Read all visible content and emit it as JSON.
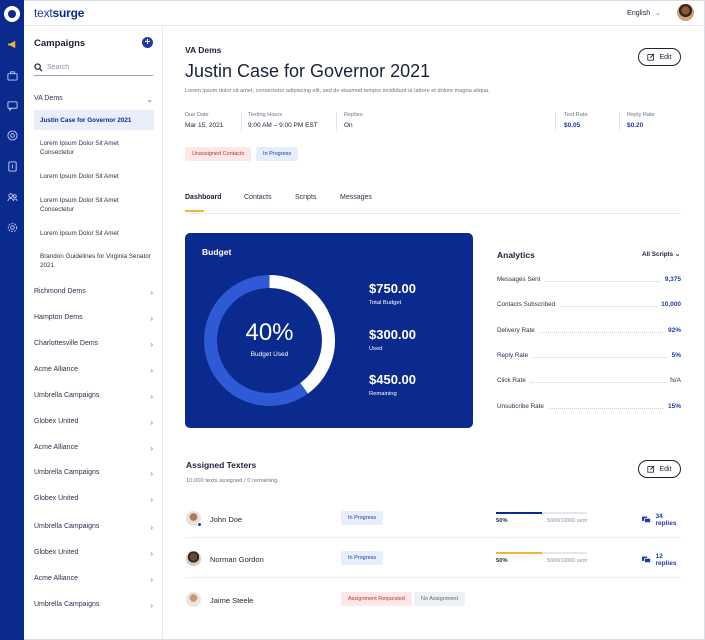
{
  "brand": {
    "name_light": "text",
    "name_bold": "surge"
  },
  "topbar": {
    "language": "English"
  },
  "sidebar": {
    "title": "Campaigns",
    "add_label": "+",
    "search_placeholder": "Search",
    "groups": [
      {
        "label": "VA Dems",
        "expanded": true
      },
      {
        "label": "Richmond Dems"
      },
      {
        "label": "Hampton Dems"
      },
      {
        "label": "Charlottesville Dems"
      },
      {
        "label": "Acme Alliance"
      },
      {
        "label": "Umbrella Campaigns"
      },
      {
        "label": "Globex United"
      },
      {
        "label": "Acme Alliance"
      },
      {
        "label": "Umbrella Campaigns"
      },
      {
        "label": "Globex United"
      },
      {
        "label": "Umbrella Campaigns"
      },
      {
        "label": "Globex United"
      },
      {
        "label": "Acme Alliance"
      },
      {
        "label": "Umbrella Campaigns"
      }
    ],
    "sub_items": [
      {
        "label": "Justin Case for Governor 2021",
        "active": true
      },
      {
        "label": "Lorem Ipsum Dolor Sit Amet Consectetur"
      },
      {
        "label": "Lorem Ipsum Dolor Sit Amet"
      },
      {
        "label": "Lorem Ipsum Dolor Sit Amet Consectetur"
      },
      {
        "label": "Lorem Ipsum Dolor Sit Amet"
      },
      {
        "label": "Brandon Guidelines for Virginia Senator 2021"
      }
    ]
  },
  "campaign": {
    "org": "VA Dems",
    "title": "Justin Case for Governor 2021",
    "description": "Lorem ipsum dolor sit amet, consectetur adipiscing elit, sed do eiusmod tempor incididunt ut labore et dolore magna aliqua.",
    "edit_label": "Edit",
    "meta": {
      "due_date_label": "Due Date",
      "due_date": "Mar 15, 2021",
      "hours_label": "Texting Hours",
      "hours": "9:00 AM – 9:00 PM EST",
      "replies_label": "Replies",
      "replies": "On",
      "text_rate_label": "Text Rate",
      "text_rate": "$0.05",
      "reply_rate_label": "Reply Rate",
      "reply_rate": "$0.20"
    },
    "badges": [
      "Unassigned Contacts",
      "In Progress"
    ]
  },
  "tabs": [
    "Dashboard",
    "Contacts",
    "Scripts",
    "Messages"
  ],
  "budget": {
    "title": "Budget",
    "used_fraction": 0.4,
    "percent_label": "40%",
    "percent_caption": "Budget Used",
    "total": "$750.00",
    "total_label": "Total Budget",
    "used": "$300.00",
    "used_label": "Used",
    "remaining": "$450.00",
    "remaining_label": "Remaining"
  },
  "analytics": {
    "title": "Analytics",
    "filter": "All Scripts",
    "rows": [
      {
        "label": "Messages Sent",
        "value": "9,375"
      },
      {
        "label": "Contacts Subscribed",
        "value": "10,000"
      },
      {
        "label": "Delivery Rate",
        "value": "92%"
      },
      {
        "label": "Reply Rate",
        "value": "5%"
      },
      {
        "label": "Click Rate",
        "value": "N/A"
      },
      {
        "label": "Unsubcribe Rate",
        "value": "15%"
      }
    ]
  },
  "texters": {
    "title": "Assigned Texters",
    "subtitle": "10,000 texts assigned / 0 remaining",
    "edit_label": "Edit",
    "rows": [
      {
        "name": "John Doe",
        "status": "In Progress",
        "progress": 0.5,
        "progress_label": "50%",
        "sent": "5000/10000 sent",
        "replies": "34 replies",
        "bar_color": "#0b2a8e"
      },
      {
        "name": "Norman Gordon",
        "status": "In Progress",
        "progress": 0.5,
        "progress_label": "50%",
        "sent": "5000/10000 sent",
        "replies": "12 replies",
        "bar_color": "#f0b43a"
      },
      {
        "name": "Jaime Steele",
        "status": "Assignment Requested",
        "status2": "No Assignment"
      }
    ]
  },
  "colors": {
    "primary": "#0b2a8e",
    "accent": "#f0b43a",
    "link": "#1d3aa8"
  }
}
